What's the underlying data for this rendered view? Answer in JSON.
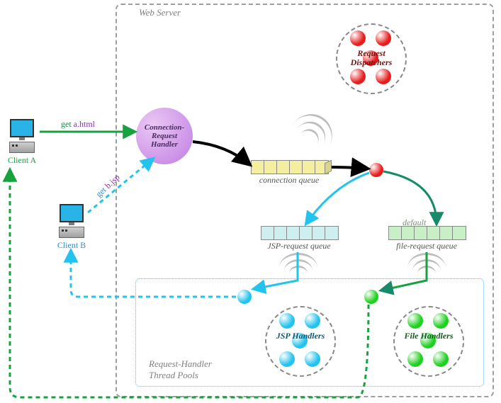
{
  "diagram": {
    "webserver_label": "Web Server",
    "thread_pools_label": "Request-Handler\nThread Pools",
    "default_label": "default"
  },
  "clients": {
    "a": {
      "label": "Client A",
      "req_prefix": "get ",
      "req_file": "a.html"
    },
    "b": {
      "label": "Client B",
      "req_prefix": "get ",
      "req_file": "b.jsp"
    }
  },
  "nodes": {
    "conn_handler": "Connection-\nRequest\nHandler",
    "request_dispatchers": "Request\nDispatchers",
    "jsp_handlers": "JSP\nHandlers",
    "file_handlers": "File\nHandlers"
  },
  "queues": {
    "connection": "connection queue",
    "jsp": "JSP-request queue",
    "file": "file-request queue"
  },
  "colors": {
    "green": "#17a23f",
    "cyan": "#22c3ee",
    "red": "#e81c1c",
    "purple": "#c07de2",
    "conn_q": "#f3eea0",
    "jsp_q": "#cdefef",
    "file_q": "#c7f0c7"
  }
}
